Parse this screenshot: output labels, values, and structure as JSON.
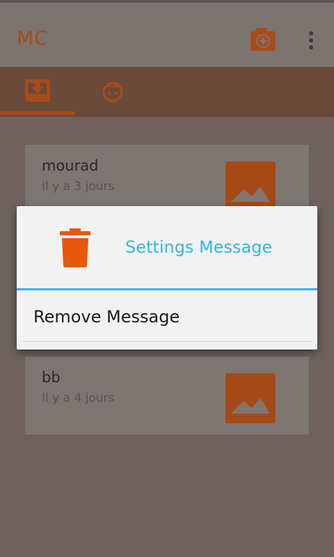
{
  "app": {
    "title": "MC"
  },
  "action_bar": {
    "camera_icon": "camera-add-icon",
    "overflow_icon": "overflow-menu-icon"
  },
  "tabs": [
    {
      "icon": "inbox-icon",
      "selected": true
    },
    {
      "icon": "face-icon",
      "selected": false
    }
  ],
  "messages": [
    {
      "name": "mourad",
      "time": "Il y a 3 jours",
      "thumb_icon": "image-icon"
    },
    {
      "name": "bb",
      "time": "Il y a 4 jours",
      "thumb_icon": "image-icon"
    }
  ],
  "dialog": {
    "title": "Settings Message",
    "icon": "trash-icon",
    "items": [
      {
        "label": "Remove Message"
      }
    ]
  },
  "colors": {
    "accent": "#E8590C",
    "dialog_title": "#33B5E5",
    "dimmed_background": "#6F615E"
  }
}
